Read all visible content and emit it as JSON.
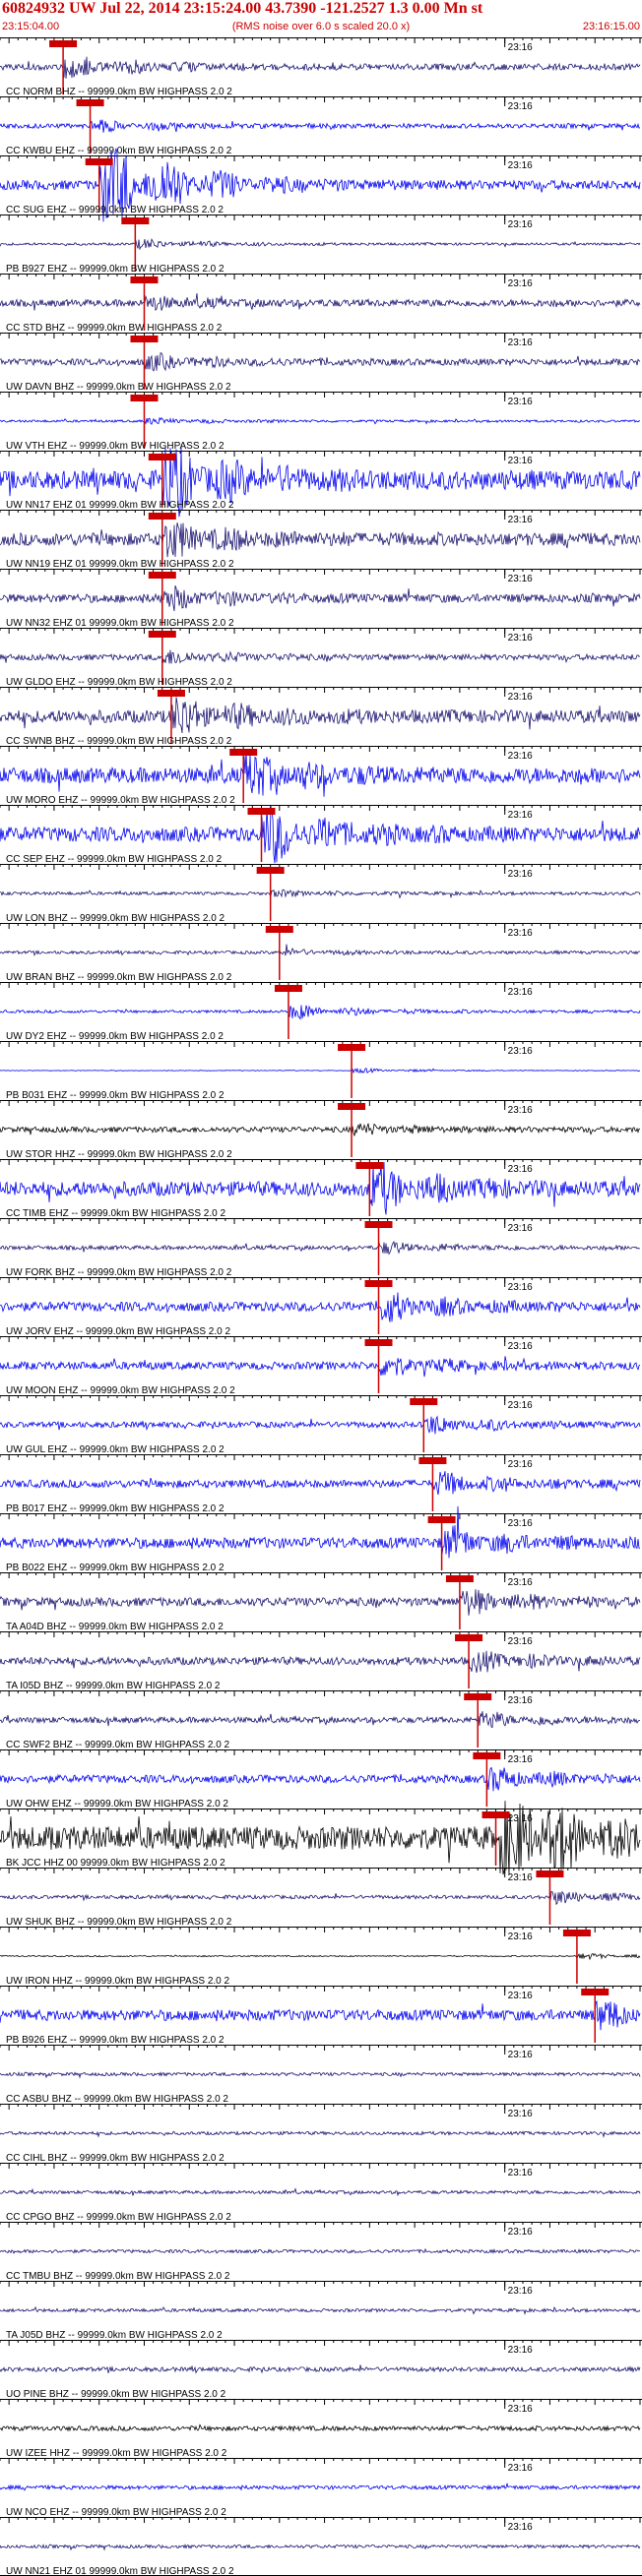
{
  "header": {
    "title": "60824932 UW Jul 22, 2014 23:15:24.00   43.7390 -121.2527  1.3 0.00 Mn st",
    "subtitle": "(RMS noise over 6.0 s scaled 20.0 x)",
    "start_time": "23:15:04.00",
    "end_time": "23:16:15.00"
  },
  "colors": {
    "red": "#cc0000",
    "blue": "#0000ee",
    "navy": "#1a1470",
    "black": "#000000"
  },
  "chart_data": {
    "type": "line",
    "title": "60824932 UW Jul 22, 2014 23:15:24.00   43.7390 -121.2527  1.3 0.00 Mn st",
    "subtitle": "(RMS noise over 6.0 s scaled 20.0 x)",
    "xlim": [
      "23:15:04.00",
      "23:16:15.00"
    ],
    "minute_label": "23:16",
    "channels": [
      {
        "label": "CC NORM BHZ -- 99999.0km BW  HIGHPASS  2.0  2",
        "color": "navy",
        "pick": "23:15:11",
        "amp": 0.55,
        "burst": 0.9,
        "noise": 0.22
      },
      {
        "label": "CC KWBU EHZ -- 99999.0km BW  HIGHPASS  2.0  2",
        "color": "blue",
        "pick": "23:15:14",
        "amp": 0.35,
        "burst": 0.6,
        "noise": 0.25
      },
      {
        "label": "CC SUG EHZ -- 99999.0km BW  HIGHPASS  2.0  2",
        "color": "blue",
        "pick": "23:15:15",
        "amp": 1.0,
        "burst": 2.6,
        "noise": 0.18
      },
      {
        "label": "PB B927 EHZ -- 99999.0km BW  HIGHPASS  2.0  2",
        "color": "navy",
        "pick": "23:15:19",
        "amp": 0.4,
        "burst": 0.5,
        "noise": 0.12
      },
      {
        "label": "CC STD BHZ -- 99999.0km BW  HIGHPASS  2.0  2",
        "color": "navy",
        "pick": "23:15:20",
        "amp": 0.45,
        "burst": 0.5,
        "noise": 0.3
      },
      {
        "label": "UW DAVN BHZ -- 99999.0km BW  HIGHPASS  2.0  2",
        "color": "navy",
        "pick": "23:15:20",
        "amp": 0.5,
        "burst": 0.6,
        "noise": 0.25
      },
      {
        "label": "UW VTH EHZ -- 99999.0km BW  HIGHPASS  2.0  2",
        "color": "blue",
        "pick": "23:15:20",
        "amp": 0.3,
        "burst": 0.4,
        "noise": 0.15
      },
      {
        "label": "UW NN17 EHZ 01 99999.0km BW  HIGHPASS  2.0  2",
        "color": "blue",
        "pick": "23:15:22",
        "amp": 0.9,
        "burst": 1.6,
        "noise": 0.4
      },
      {
        "label": "UW NN19 EHZ 01 99999.0km BW  HIGHPASS  2.0  2",
        "color": "navy",
        "pick": "23:15:22",
        "amp": 0.7,
        "burst": 1.0,
        "noise": 0.35
      },
      {
        "label": "UW NN32 EHZ 01 99999.0km BW  HIGHPASS  2.0  2",
        "color": "navy",
        "pick": "23:15:22",
        "amp": 0.55,
        "burst": 0.8,
        "noise": 0.3
      },
      {
        "label": "UW GLDO EHZ -- 99999.0km BW  HIGHPASS  2.0  2",
        "color": "navy",
        "pick": "23:15:22",
        "amp": 0.45,
        "burst": 0.6,
        "noise": 0.25
      },
      {
        "label": "CC SWNB BHZ -- 99999.0km BW  HIGHPASS  2.0  2",
        "color": "navy",
        "pick": "23:15:23",
        "amp": 0.7,
        "burst": 1.1,
        "noise": 0.35
      },
      {
        "label": "UW MORO EHZ -- 99999.0km BW  HIGHPASS  2.0  2",
        "color": "blue",
        "pick": "23:15:31",
        "amp": 0.75,
        "burst": 1.0,
        "noise": 0.4
      },
      {
        "label": "CC SEP EHZ -- 99999.0km BW  HIGHPASS  2.0  2",
        "color": "blue",
        "pick": "23:15:33",
        "amp": 0.8,
        "burst": 1.4,
        "noise": 0.35
      },
      {
        "label": "UW LON BHZ -- 99999.0km BW  HIGHPASS  2.0  2",
        "color": "navy",
        "pick": "23:15:34",
        "amp": 0.3,
        "burst": 0.4,
        "noise": 0.2
      },
      {
        "label": "UW BRAN BHZ -- 99999.0km BW  HIGHPASS  2.0  2",
        "color": "navy",
        "pick": "23:15:35",
        "amp": 0.3,
        "burst": 0.4,
        "noise": 0.2
      },
      {
        "label": "UW DY2 EHZ -- 99999.0km BW  HIGHPASS  2.0  2",
        "color": "blue",
        "pick": "23:15:36",
        "amp": 0.35,
        "burst": 0.9,
        "noise": 0.15
      },
      {
        "label": "PB B031 EHZ -- 99999.0km BW  HIGHPASS  2.0  2",
        "color": "blue",
        "pick": "23:15:43",
        "amp": 0.2,
        "burst": 0.5,
        "noise": 0.06
      },
      {
        "label": "UW STOR HHZ -- 99999.0km BW  HIGHPASS  2.0  2",
        "color": "black",
        "pick": "23:15:43",
        "amp": 0.35,
        "burst": 0.6,
        "noise": 0.3
      },
      {
        "label": "CC TIMB EHZ -- 99999.0km BW  HIGHPASS  2.0  2",
        "color": "blue",
        "pick": "23:15:45",
        "amp": 0.8,
        "burst": 1.2,
        "noise": 0.35
      },
      {
        "label": "UW FORK BHZ -- 99999.0km BW  HIGHPASS  2.0  2",
        "color": "navy",
        "pick": "23:15:46",
        "amp": 0.4,
        "burst": 0.6,
        "noise": 0.2
      },
      {
        "label": "UW JORV EHZ -- 99999.0km BW  HIGHPASS  2.0  2",
        "color": "blue",
        "pick": "23:15:46",
        "amp": 0.6,
        "burst": 1.0,
        "noise": 0.3
      },
      {
        "label": "UW MOON EHZ -- 99999.0km BW  HIGHPASS  2.0  2",
        "color": "blue",
        "pick": "23:15:46",
        "amp": 0.5,
        "burst": 0.8,
        "noise": 0.3
      },
      {
        "label": "UW GUL EHZ -- 99999.0km BW  HIGHPASS  2.0  2",
        "color": "blue",
        "pick": "23:15:51",
        "amp": 0.45,
        "burst": 0.8,
        "noise": 0.25
      },
      {
        "label": "PB B017 EHZ -- 99999.0km BW  HIGHPASS  2.0  2",
        "color": "blue",
        "pick": "23:15:52",
        "amp": 0.5,
        "burst": 0.9,
        "noise": 0.3
      },
      {
        "label": "PB B022 EHZ -- 99999.0km BW  HIGHPASS  2.0  2",
        "color": "blue",
        "pick": "23:15:53",
        "amp": 0.6,
        "burst": 1.0,
        "noise": 0.35
      },
      {
        "label": "TA A04D BHZ -- 99999.0km BW  HIGHPASS  2.0  2",
        "color": "navy",
        "pick": "23:15:55",
        "amp": 0.55,
        "burst": 0.9,
        "noise": 0.3
      },
      {
        "label": "TA I05D BHZ -- 99999.0km BW  HIGHPASS  2.0  2",
        "color": "navy",
        "pick": "23:15:56",
        "amp": 0.5,
        "burst": 0.8,
        "noise": 0.3
      },
      {
        "label": "CC SWF2 BHZ -- 99999.0km BW  HIGHPASS  2.0  2",
        "color": "navy",
        "pick": "23:15:57",
        "amp": 0.45,
        "burst": 0.7,
        "noise": 0.25
      },
      {
        "label": "UW OHW EHZ -- 99999.0km BW  HIGHPASS  2.0  2",
        "color": "blue",
        "pick": "23:15:58",
        "amp": 0.5,
        "burst": 0.9,
        "noise": 0.3
      },
      {
        "label": "BK JCC HHZ 00 99999.0km BW  HIGHPASS  2.0  2",
        "color": "black",
        "pick": "23:15:59",
        "amp": 1.0,
        "burst": 2.4,
        "noise": 0.45
      },
      {
        "label": "UW SHUK BHZ -- 99999.0km BW  HIGHPASS  2.0  2",
        "color": "navy",
        "pick": "23:16:05",
        "amp": 0.35,
        "burst": 0.8,
        "noise": 0.2
      },
      {
        "label": "UW IRON HHZ -- 99999.0km BW  HIGHPASS  2.0  2",
        "color": "black",
        "pick": "23:16:08",
        "amp": 0.3,
        "burst": 0.4,
        "noise": 0.08
      },
      {
        "label": "PB B926 EHZ -- 99999.0km BW  HIGHPASS  2.0  2",
        "color": "blue",
        "pick": "23:16:10",
        "amp": 0.6,
        "burst": 0.9,
        "noise": 0.35
      },
      {
        "label": "CC ASBU BHZ -- 99999.0km BW  HIGHPASS  2.0  2",
        "color": "navy",
        "pick": "",
        "amp": 0.25,
        "burst": 0,
        "noise": 0.25
      },
      {
        "label": "CC CIHL BHZ -- 99999.0km BW  HIGHPASS  2.0  2",
        "color": "navy",
        "pick": "",
        "amp": 0.25,
        "burst": 0,
        "noise": 0.25
      },
      {
        "label": "CC CPGO BHZ -- 99999.0km BW  HIGHPASS  2.0  2",
        "color": "navy",
        "pick": "",
        "amp": 0.25,
        "burst": 0,
        "noise": 0.25
      },
      {
        "label": "CC TMBU BHZ -- 99999.0km BW  HIGHPASS  2.0  2",
        "color": "navy",
        "pick": "",
        "amp": 0.25,
        "burst": 0,
        "noise": 0.25
      },
      {
        "label": "TA J05D BHZ -- 99999.0km BW  HIGHPASS  2.0  2",
        "color": "navy",
        "pick": "",
        "amp": 0.25,
        "burst": 0,
        "noise": 0.25
      },
      {
        "label": "UO PINE BHZ -- 99999.0km BW  HIGHPASS  2.0  2",
        "color": "navy",
        "pick": "",
        "amp": 0.3,
        "burst": 0,
        "noise": 0.28
      },
      {
        "label": "UW IZEE HHZ -- 99999.0km BW  HIGHPASS  2.0  2",
        "color": "black",
        "pick": "",
        "amp": 0.3,
        "burst": 0,
        "noise": 0.3
      },
      {
        "label": "UW NCO EHZ -- 99999.0km BW  HIGHPASS  2.0  2",
        "color": "blue",
        "pick": "",
        "amp": 0.3,
        "burst": 0,
        "noise": 0.25
      },
      {
        "label": "UW NN21 EHZ 01 99999.0km BW  HIGHPASS  2.0  2",
        "color": "navy",
        "pick": "",
        "amp": 0.25,
        "burst": 0,
        "noise": 0.25
      }
    ]
  }
}
